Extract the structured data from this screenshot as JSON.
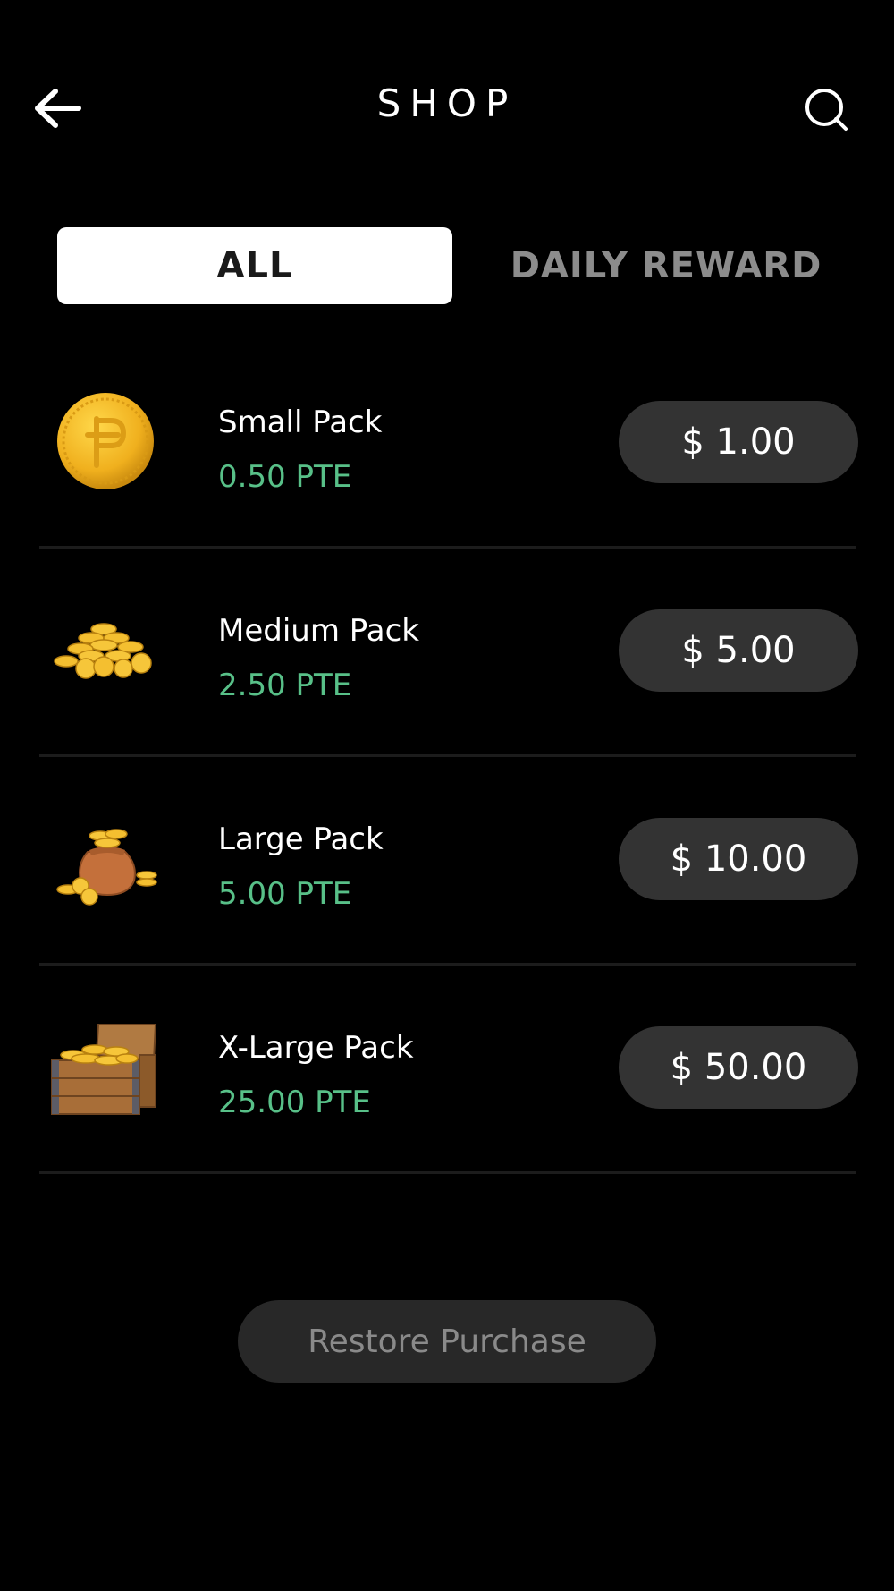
{
  "header": {
    "title": "SHOP",
    "back_icon": "arrow-left-icon",
    "search_icon": "search-icon"
  },
  "tabs": [
    {
      "label": "ALL",
      "selected": true
    },
    {
      "label": "DAILY REWARD",
      "selected": false
    }
  ],
  "packs": [
    {
      "name": "Small Pack",
      "amount": "0.50 PTE",
      "price": "$ 1.00",
      "icon": "single-coin-icon"
    },
    {
      "name": "Medium Pack",
      "amount": "2.50 PTE",
      "price": "$ 5.00",
      "icon": "coin-pile-icon"
    },
    {
      "name": "Large Pack",
      "amount": "5.00 PTE",
      "price": "$ 10.00",
      "icon": "coin-sack-icon"
    },
    {
      "name": "X-Large Pack",
      "amount": "25.00 PTE",
      "price": "$ 50.00",
      "icon": "treasure-chest-icon"
    }
  ],
  "restore": {
    "label": "Restore Purchase"
  },
  "colors": {
    "background": "#000000",
    "accent_green": "#58c088",
    "button_dark": "#333333",
    "tab_selected_bg": "#ffffff",
    "tab_inactive_text": "#8c8c8c",
    "gold": "#f2b92a"
  }
}
